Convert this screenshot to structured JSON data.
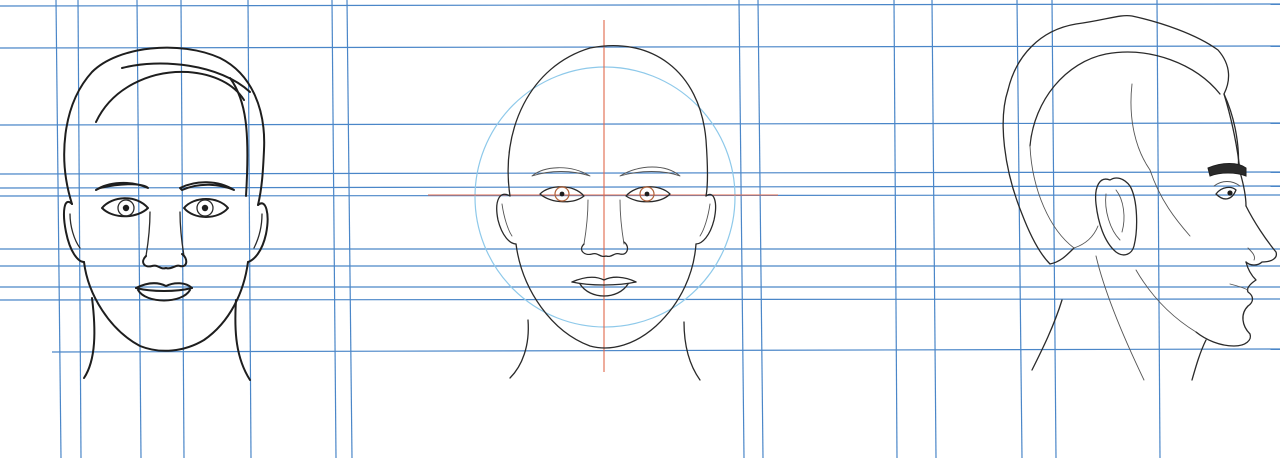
{
  "drawing": {
    "colors": {
      "background": "#ffffff",
      "ink": "#1e1e1e",
      "grid": "#4a86c8",
      "guide_circle": "#8ec9ea",
      "crosshair": "#e0684b",
      "iris_warm": "#b0623a"
    },
    "views": [
      "front-view-face",
      "front-view-head-construction",
      "side-profile-head"
    ]
  }
}
